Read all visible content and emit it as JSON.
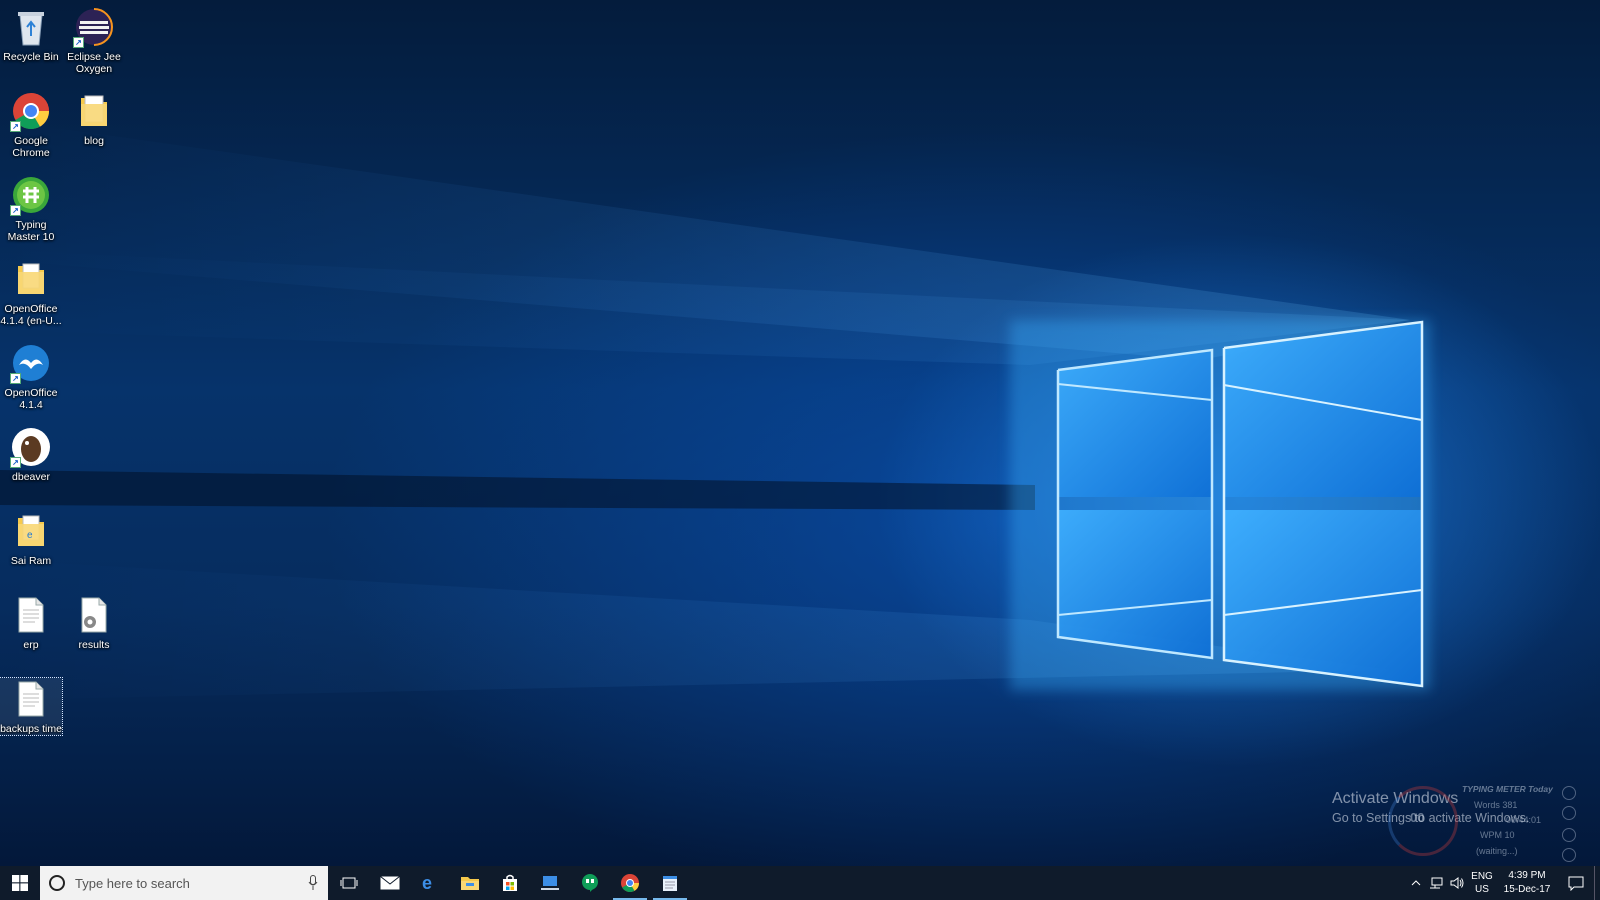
{
  "desktop": {
    "icons": [
      {
        "label": "Recycle Bin",
        "icon": "recycle-bin-icon"
      },
      {
        "label": "Eclipse Jee Oxygen",
        "icon": "eclipse-icon"
      },
      {
        "label": "Google Chrome",
        "icon": "chrome-icon"
      },
      {
        "label": "blog",
        "icon": "folder-icon"
      },
      {
        "label": "Typing Master 10",
        "icon": "typing-master-icon"
      },
      {
        "label": "OpenOffice 4.1.4 (en-U...",
        "icon": "folder-icon"
      },
      {
        "label": "OpenOffice 4.1.4",
        "icon": "openoffice-icon"
      },
      {
        "label": "dbeaver",
        "icon": "dbeaver-icon"
      },
      {
        "label": "Sai Ram",
        "icon": "folder-icon"
      },
      {
        "label": "erp",
        "icon": "text-file-icon"
      },
      {
        "label": "results",
        "icon": "settings-file-icon"
      },
      {
        "label": "backups time",
        "icon": "text-file-icon"
      }
    ]
  },
  "watermark": {
    "title": "Activate Windows",
    "subtitle": "Go to Settings to activate Windows."
  },
  "typing_meter": {
    "title": "TYPING METER Today",
    "words": "Words  381",
    "time": "00:44:01",
    "wpm": "WPM  10",
    "waiting": "(waiting...)",
    "gauge_value": "00"
  },
  "taskbar": {
    "search_placeholder": "Type here to search",
    "apps": [
      "task-view-icon",
      "mail-icon",
      "edge-icon",
      "file-explorer-icon",
      "store-icon",
      "remote-desktop-icon",
      "hangouts-icon",
      "chrome-icon",
      "notepad-icon"
    ],
    "tray": {
      "language_top": "ENG",
      "language_bottom": "US",
      "time": "4:39 PM",
      "date": "15-Dec-17"
    }
  },
  "colors": {
    "accent": "#76b9ed",
    "taskbar": "#0f1b2b",
    "wallpaper_light": "#3aa8ff"
  }
}
